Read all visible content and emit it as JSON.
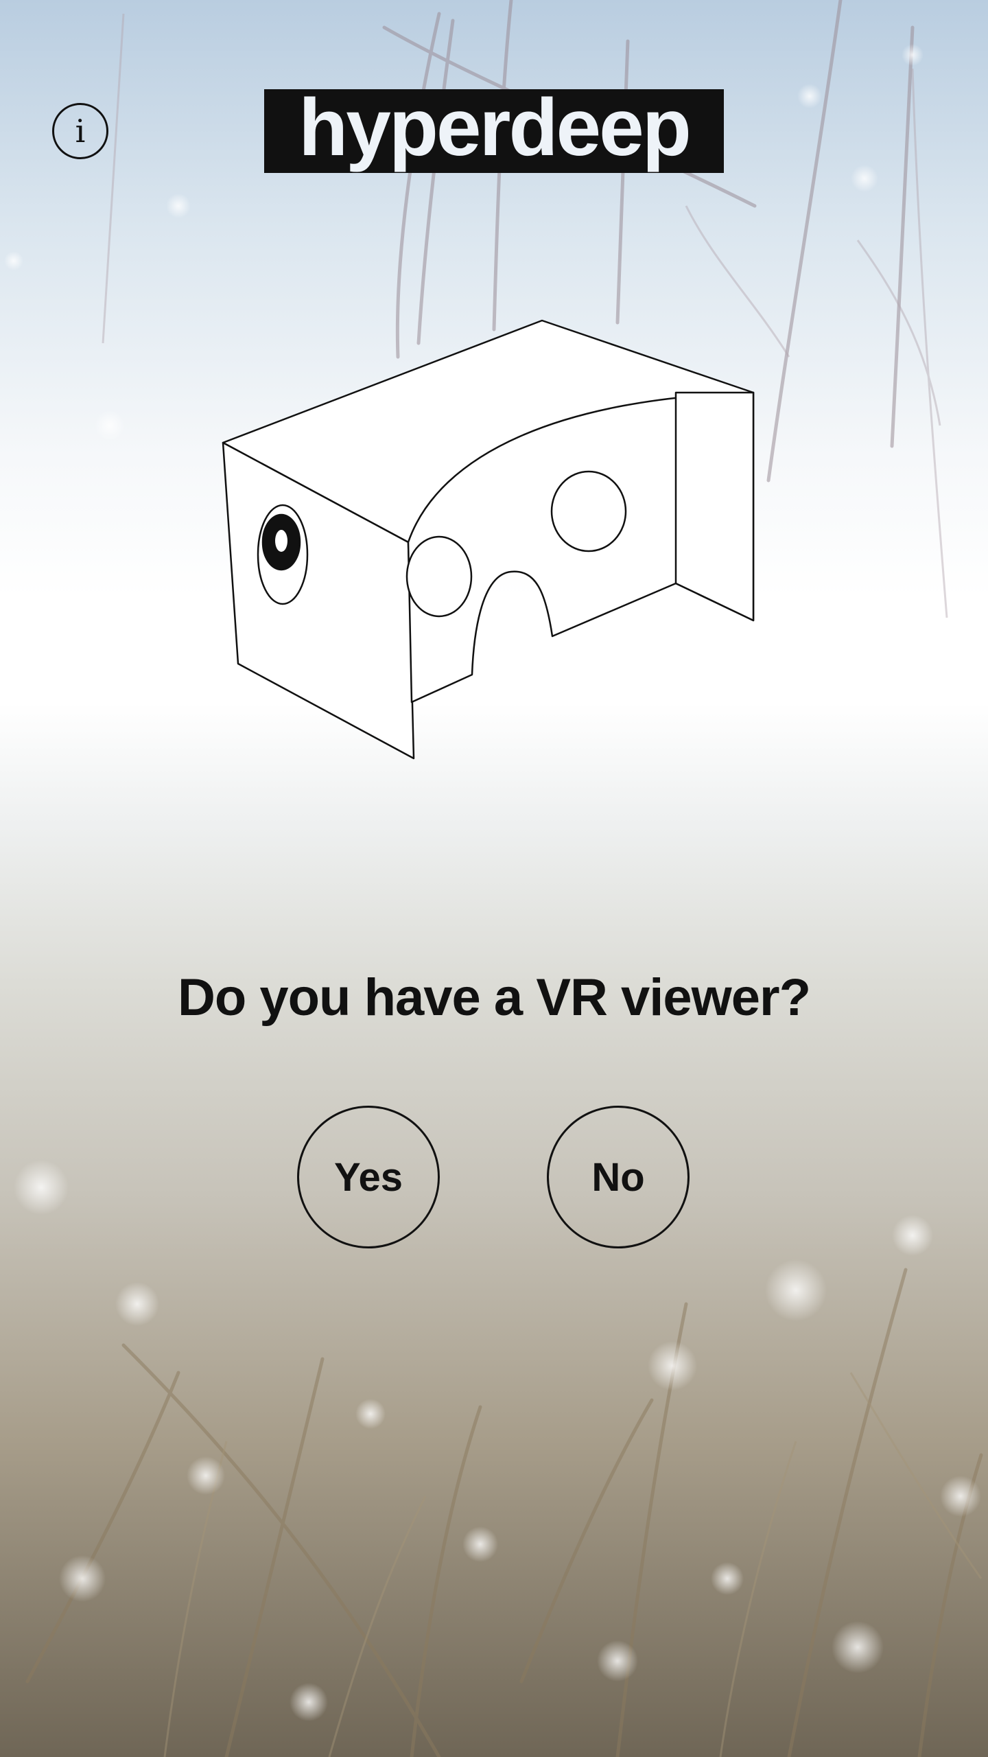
{
  "app": {
    "logo_text": "hyperdeep",
    "info_glyph": "i"
  },
  "icons": {
    "info": "info-icon",
    "viewer": "vr-viewer-icon"
  },
  "prompt": {
    "question": "Do you have a VR viewer?",
    "yes_label": "Yes",
    "no_label": "No"
  },
  "colors": {
    "logo_background": "#111111",
    "logo_text": "#eef3f8",
    "text": "#111111",
    "sky_top": "#b9cde0",
    "mist": "#ffffff",
    "ground": "#8a7f6d"
  }
}
